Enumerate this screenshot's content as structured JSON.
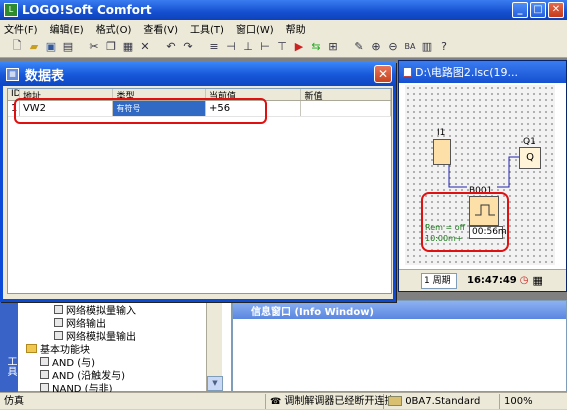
{
  "app": {
    "title": "LOGO!Soft Comfort"
  },
  "menu": [
    "文件(F)",
    "编辑(E)",
    "格式(O)",
    "查看(V)",
    "工具(T)",
    "窗口(W)",
    "帮助"
  ],
  "toolbar_icons": [
    "new-icon",
    "open-icon",
    "save-icon",
    "print-icon",
    "cut-icon",
    "copy-icon",
    "paste-icon",
    "delete-icon",
    "undo-icon",
    "redo-icon",
    "connector-icon",
    "zoom-in-icon",
    "zoom-out-icon",
    "help-icon"
  ],
  "dialog": {
    "title": "数据表",
    "columns": [
      "ID",
      "地址",
      "类型",
      "当前值",
      "新值"
    ],
    "rows": [
      {
        "id": "1",
        "address": "VW2",
        "type": "有符号",
        "current": "+56",
        "new": ""
      }
    ]
  },
  "circuit": {
    "title": "D:\\电路图2.lsc(19...",
    "input_label": "I1",
    "output_label": "Q1",
    "output_text": "Q",
    "block_label": "B001",
    "block_params": [
      "Rem = off",
      "10:00m+"
    ],
    "block_time": "00:56m",
    "cycle_label": "1 周期",
    "clock": "16:47:49"
  },
  "tree": {
    "tab_label": "工具",
    "items": [
      "网络模拟量输入",
      "网络输出",
      "网络模拟量输出",
      "基本功能块",
      "AND (与)",
      "AND (沿触发与)",
      "NAND (与非)"
    ]
  },
  "info_window": {
    "title": "信息窗口 (Info Window)"
  },
  "status": {
    "mode": "仿真",
    "connection": "调制解调器已经断开连接",
    "device": "0BA7.Standard",
    "zoom": "100%"
  },
  "colors": {
    "title_blue": "#1550d0",
    "highlight_red": "#e01010",
    "selection": "#316ac5"
  }
}
